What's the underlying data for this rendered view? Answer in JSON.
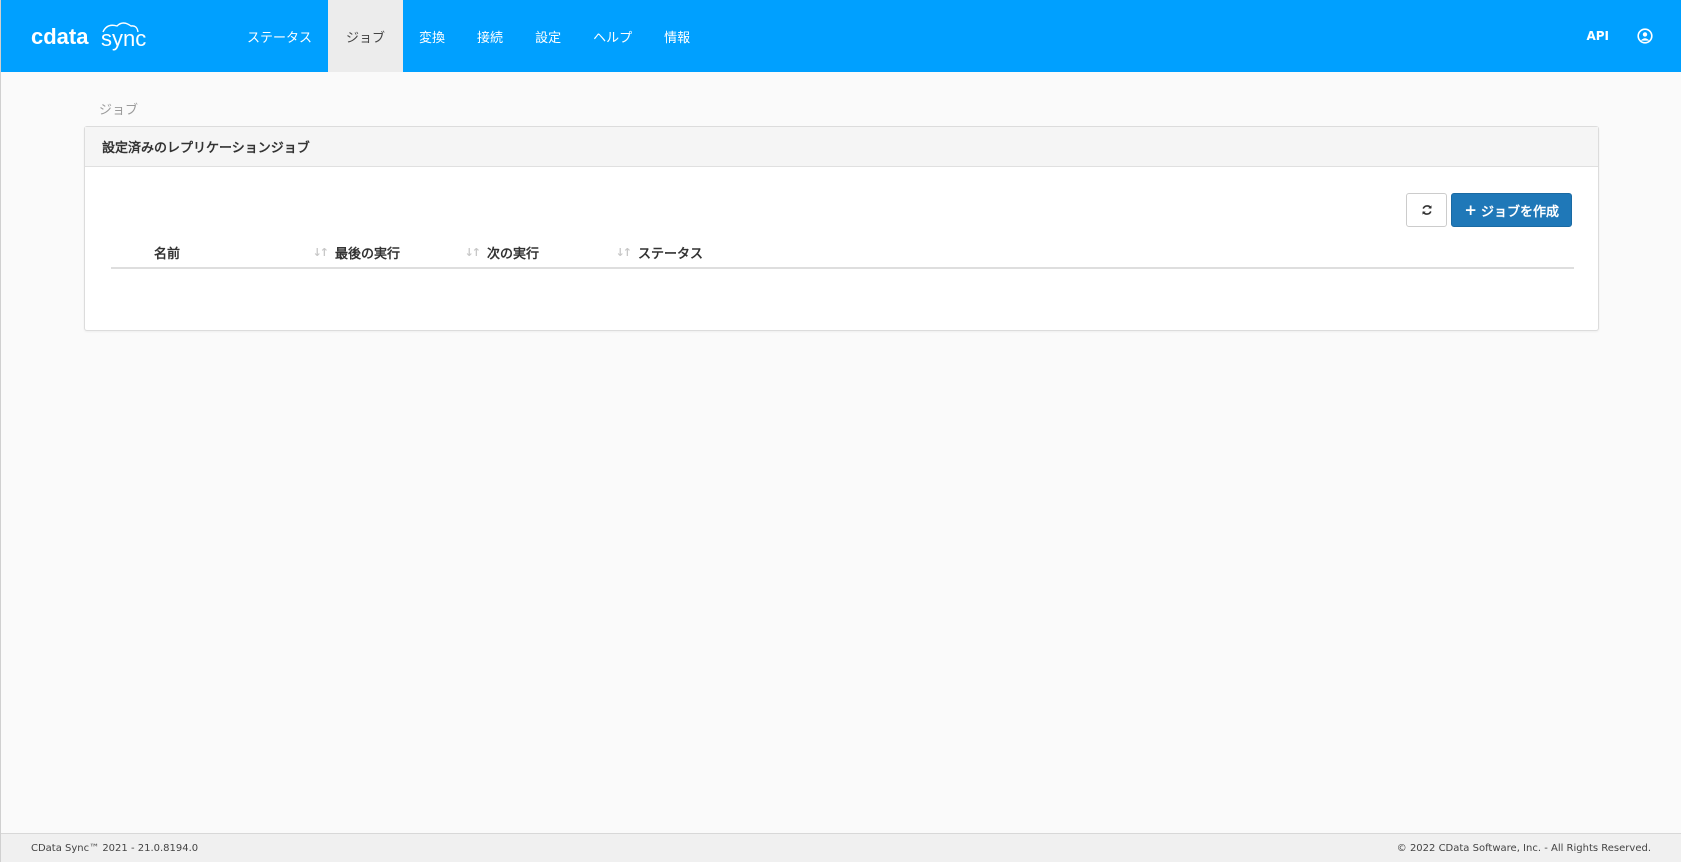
{
  "brand": {
    "name_a": "cdata",
    "name_b": "sync"
  },
  "nav": {
    "items": [
      {
        "label": "ステータス"
      },
      {
        "label": "ジョブ",
        "active": true
      },
      {
        "label": "変換"
      },
      {
        "label": "接続"
      },
      {
        "label": "設定"
      },
      {
        "label": "ヘルプ"
      },
      {
        "label": "情報"
      }
    ],
    "api_label": "API",
    "user_icon": "user-circle-icon"
  },
  "breadcrumb": "ジョブ",
  "panel": {
    "title": "設定済みのレプリケーションジョブ",
    "refresh_icon": "refresh-icon",
    "create_label": "ジョブを作成",
    "table": {
      "columns": [
        "名前",
        "最後の実行",
        "次の実行",
        "ステータス"
      ],
      "rows": []
    }
  },
  "footer": {
    "left": "CData Sync™ 2021 - 21.0.8194.0",
    "right": "© 2022 CData Software, Inc. - All Rights Reserved."
  },
  "colors": {
    "navbar": "#00a0ff",
    "primary_button": "#1f78b8",
    "active_tab": "#ececec"
  }
}
